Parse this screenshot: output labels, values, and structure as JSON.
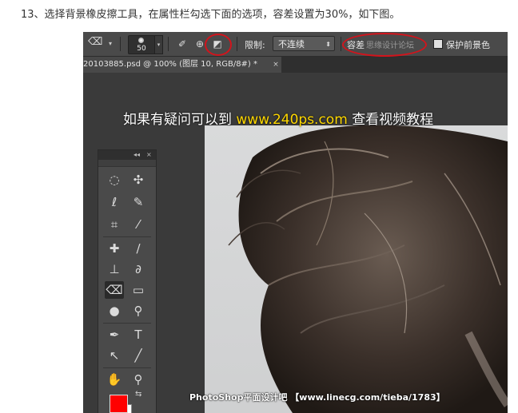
{
  "caption": "13、选择背景橡皮擦工具，在属性栏勾选下面的选项，容差设置为30%，如下图。",
  "options_bar": {
    "brush_size": "50",
    "limit_label": "限制:",
    "limit_value": "不连续",
    "tolerance_label": "容差",
    "protect_label": "保护前景色",
    "watermark_text": "思缘设计论坛"
  },
  "document_tab": {
    "title": "20103885.psd @ 100% (图层 10, RGB/8#) *",
    "close": "×"
  },
  "watermarks": {
    "top_prefix": "如果有疑问可以到",
    "top_site": "www.240ps.com",
    "top_suffix": "查看视频教程",
    "bottom": "PhotoShop平面设计吧 【www.linecg.com/tieba/1783】"
  },
  "tools_panel": {
    "collapse": "◂◂",
    "close": "×",
    "tools": [
      {
        "icon": "elliptical-marquee-icon",
        "glyph": "◌"
      },
      {
        "icon": "move-tool-icon",
        "glyph": "✣"
      },
      {
        "icon": "lasso-icon",
        "glyph": "ℓ"
      },
      {
        "icon": "quick-selection-icon",
        "glyph": "✎"
      },
      {
        "icon": "crop-icon",
        "glyph": "⌗"
      },
      {
        "icon": "eyedropper-icon",
        "glyph": "⁄"
      },
      {
        "icon": "healing-brush-icon",
        "glyph": "✚"
      },
      {
        "icon": "brush-icon",
        "glyph": "∕"
      },
      {
        "icon": "clone-stamp-icon",
        "glyph": "⊥"
      },
      {
        "icon": "history-brush-icon",
        "glyph": "∂"
      },
      {
        "icon": "background-eraser-icon",
        "glyph": "⌫"
      },
      {
        "icon": "gradient-icon",
        "glyph": "▭"
      },
      {
        "icon": "blur-icon",
        "glyph": "●"
      },
      {
        "icon": "dodge-icon",
        "glyph": "⚲"
      },
      {
        "icon": "pen-icon",
        "glyph": "✒"
      },
      {
        "icon": "type-icon",
        "glyph": "T"
      },
      {
        "icon": "path-selection-icon",
        "glyph": "↖"
      },
      {
        "icon": "line-icon",
        "glyph": "╱"
      },
      {
        "icon": "hand-icon",
        "glyph": "✋"
      },
      {
        "icon": "zoom-icon",
        "glyph": "⚲"
      }
    ],
    "foreground_color": "#ff0000",
    "background_color": "#ffffff"
  },
  "colors": {
    "highlight_circle": "#d2141c",
    "watermark_yellow": "#ffd800"
  }
}
